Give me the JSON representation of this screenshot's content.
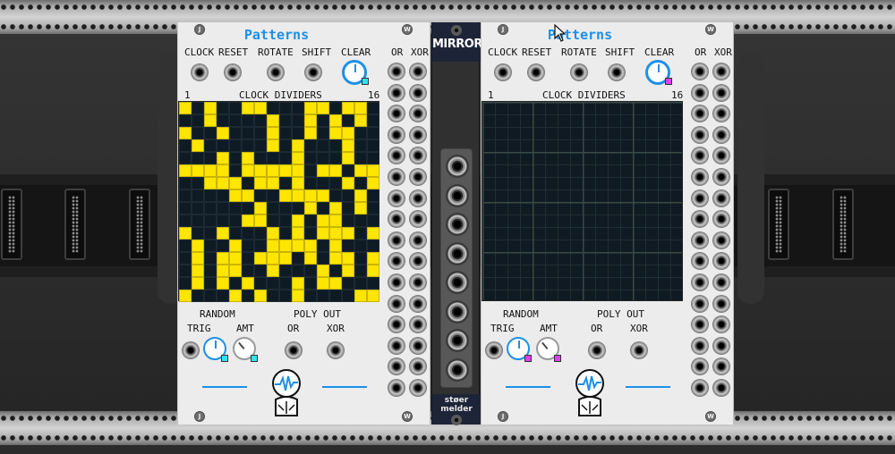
{
  "rack": {
    "connector_count": 6
  },
  "left_module": {
    "title": "Patterns",
    "screw_top_left": "J",
    "screw_top_right": "W",
    "screw_bottom_left": "J",
    "screw_bottom_right": "W",
    "inputs": {
      "clock": "CLOCK",
      "reset": "RESET",
      "rotate": "ROTATE",
      "shift": "SHIFT",
      "clear": "CLEAR"
    },
    "outputs_header": {
      "or": "OR",
      "xor": "XOR"
    },
    "divider_label": {
      "start": "1",
      "title": "CLOCK DIVIDERS",
      "end": "16"
    },
    "random": {
      "title": "RANDOM",
      "trig": "TRIG",
      "amt": "AMT"
    },
    "poly_out": {
      "title": "POLY OUT",
      "or": "OR",
      "xor": "XOR"
    },
    "grid_rows": [
      "1010011000110110",
      "0010000100101010",
      "1001000100101100",
      "0100000101000100",
      "0001010001000100",
      "1111011111011011",
      "0011101101000101",
      "0000110011110010",
      "0000001000101010",
      "0000011001011000",
      "1001000101011101",
      "0100100111101000",
      "0101101110101101",
      "0101100100010101",
      "0101010001011000",
      "1000101001000011"
    ]
  },
  "mirror_module": {
    "title": "MIRROR",
    "brand_line1": "støer",
    "brand_line2": "melder"
  },
  "right_module": {
    "title": "Patterns",
    "screw_top_left": "J",
    "screw_top_right": "W",
    "screw_bottom_left": "J",
    "screw_bottom_right": "W",
    "inputs": {
      "clock": "CLOCK",
      "reset": "RESET",
      "rotate": "ROTATE",
      "shift": "SHIFT",
      "clear": "CLEAR"
    },
    "outputs_header": {
      "or": "OR",
      "xor": "XOR"
    },
    "divider_label": {
      "start": "1",
      "title": "CLOCK DIVIDERS",
      "end": "16"
    },
    "random": {
      "title": "RANDOM",
      "trig": "TRIG",
      "amt": "AMT"
    },
    "poly_out": {
      "title": "POLY OUT",
      "or": "OR",
      "xor": "XOR"
    }
  },
  "colors": {
    "accent_blue": "#1e90e6",
    "cell_on": "#ffe600",
    "led_left": "#30e3f2",
    "led_right": "#e33ff0"
  }
}
